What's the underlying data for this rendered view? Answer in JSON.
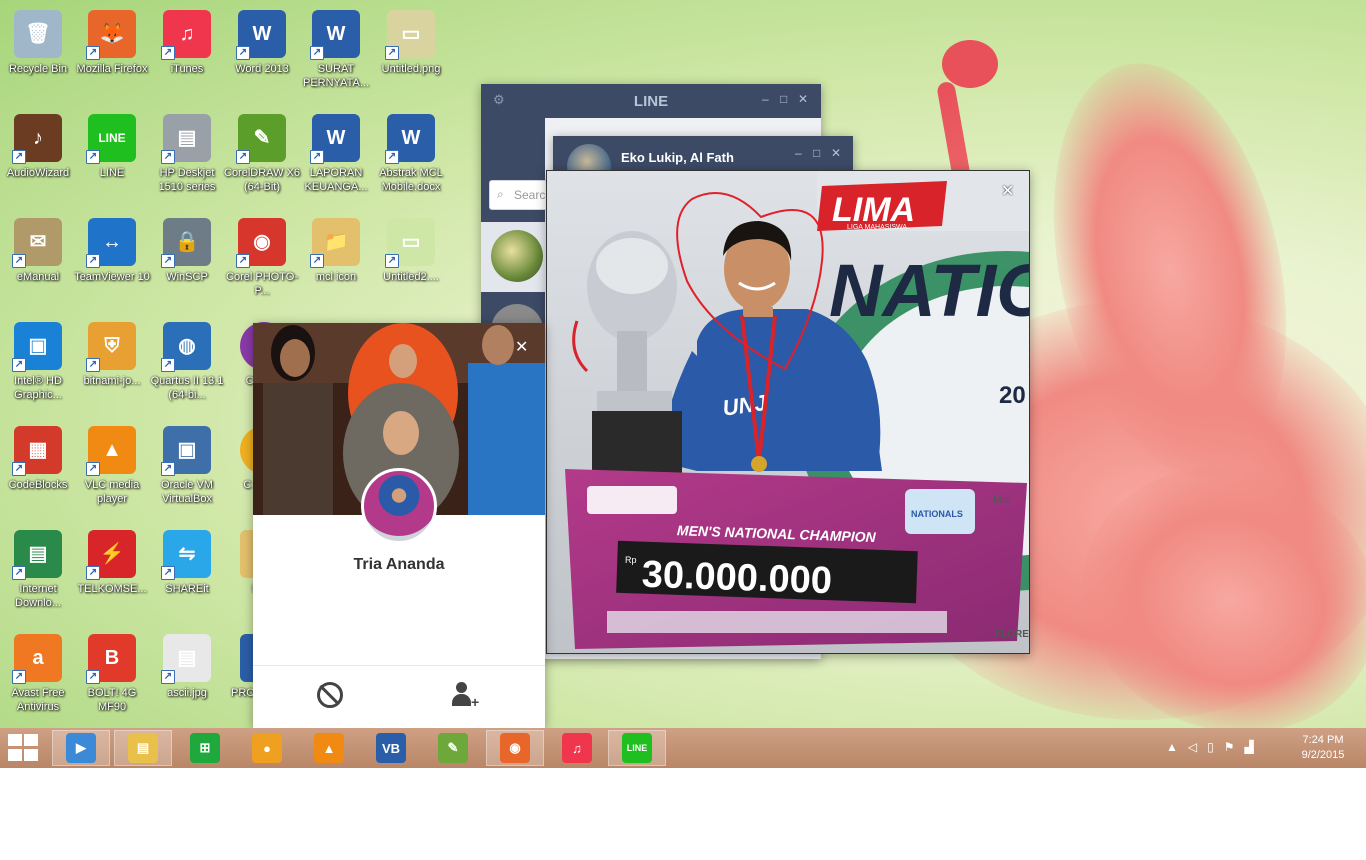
{
  "desktop_icons": [
    {
      "label": "Recycle Bin",
      "glyph": "🗑",
      "color": "#9fb7c9"
    },
    {
      "label": "Mozilla Firefox",
      "glyph": "🦊",
      "color": "#e8662a"
    },
    {
      "label": "iTunes",
      "glyph": "♫",
      "color": "#f0364c"
    },
    {
      "label": "Word 2013",
      "glyph": "W",
      "color": "#2b5ea8"
    },
    {
      "label": "SURAT PERNYATA...",
      "glyph": "W",
      "color": "#2b5ea8"
    },
    {
      "label": "Untitled.png",
      "glyph": "▭",
      "color": "#d9d3a0"
    },
    {
      "label": "AudioWizard",
      "glyph": "♪",
      "color": "#6b3b22"
    },
    {
      "label": "LINE",
      "glyph": "LINE",
      "color": "#1ebf1e"
    },
    {
      "label": "HP Deskjet 1510 series",
      "glyph": "▤",
      "color": "#9aa0a8"
    },
    {
      "label": "CorelDRAW X6 (64-Bit)",
      "glyph": "✎",
      "color": "#5c9e2a"
    },
    {
      "label": "LAPORAN KEUANGA...",
      "glyph": "W",
      "color": "#2b5ea8"
    },
    {
      "label": "Abstrak MCL Mobile.docx",
      "glyph": "W",
      "color": "#2b5ea8"
    },
    {
      "label": "eManual",
      "glyph": "✉",
      "color": "#b09a6a"
    },
    {
      "label": "TeamViewer 10",
      "glyph": "↔",
      "color": "#1f74c9"
    },
    {
      "label": "WinSCP",
      "glyph": "🔒",
      "color": "#6e7c88"
    },
    {
      "label": "Corel PHOTO-P...",
      "glyph": "◉",
      "color": "#d6362b"
    },
    {
      "label": "mcl icon",
      "glyph": "📁",
      "color": "#e2c06c"
    },
    {
      "label": "Untitled2....",
      "glyph": "▭",
      "color": "#cfe7a6"
    },
    {
      "label": "Intel® HD Graphic...",
      "glyph": "▣",
      "color": "#1a82d6"
    },
    {
      "label": "bitnami-jo...",
      "glyph": "⛨",
      "color": "#e8a032"
    },
    {
      "label": "Quartus II 13.1 (64-bi...",
      "glyph": "◍",
      "color": "#2a6fb8"
    },
    {
      "label": "CodeBlocks",
      "glyph": "▦",
      "color": "#d43a2a"
    },
    {
      "label": "VLC media player",
      "glyph": "▲",
      "color": "#f08a12"
    },
    {
      "label": "Oracle VM VirtualBox",
      "glyph": "▣",
      "color": "#3f6fa8"
    },
    {
      "label": "Internet Downlo...",
      "glyph": "▤",
      "color": "#2a8a4a"
    },
    {
      "label": "TELKOMSE...",
      "glyph": "⚡",
      "color": "#d8252a"
    },
    {
      "label": "SHAREit",
      "glyph": "⇋",
      "color": "#2aa7e8"
    },
    {
      "label": "Avast Free Antivirus",
      "glyph": "a",
      "color": "#f07822"
    },
    {
      "label": "BOLT! 4G MF90",
      "glyph": "B",
      "color": "#e23a2a"
    },
    {
      "label": "ascii.jpg",
      "glyph": "▤",
      "color": "#e8e8e8"
    }
  ],
  "partial_icons": [
    {
      "label": "C CO...",
      "color": "#8a3aa8"
    },
    {
      "label": "C CAP...",
      "color": "#f0b020"
    },
    {
      "label": "PR...",
      "color": "#e2c06c"
    },
    {
      "label": "PRO LENG...",
      "color": "#2b5ea8"
    }
  ],
  "line_main": {
    "title": "LINE",
    "search_placeholder": "Search"
  },
  "chat_window": {
    "title": "Eko Lukip, Al Fath"
  },
  "profile": {
    "name": "Tria Ananda",
    "cover_colors": {
      "bg": "#4a2a1e",
      "hijab1": "#e8521e",
      "hijab2": "#6e6a62",
      "shirt": "#2a74c4"
    }
  },
  "photo": {
    "banner": "LIMA",
    "subbanner": "LIGA MAHASISWA",
    "event": "NATIO",
    "year": "20",
    "check_title": "MEN'S NATIONAL CHAMPION",
    "check_prefix": "Rp",
    "check_amount": "30.000.000",
    "shirt_text": "UNJ",
    "sponsor_right": "Mic",
    "floor_text": "FLORE",
    "badge": "NATIONALS"
  },
  "taskbar": {
    "time": "7:24 PM",
    "date": "9/2/2015",
    "apps": [
      {
        "name": "media-player",
        "glyph": "▶",
        "color": "#3a8ad8"
      },
      {
        "name": "file-explorer",
        "glyph": "▤",
        "color": "#e8c04a"
      },
      {
        "name": "store",
        "glyph": "⊞",
        "color": "#1fa83c"
      },
      {
        "name": "browser-orb",
        "glyph": "●",
        "color": "#f0a020"
      },
      {
        "name": "vlc",
        "glyph": "▲",
        "color": "#f08a12"
      },
      {
        "name": "virtualbox",
        "glyph": "VB",
        "color": "#2a5ea8"
      },
      {
        "name": "notepad",
        "glyph": "✎",
        "color": "#6ea83a"
      },
      {
        "name": "firefox",
        "glyph": "◉",
        "color": "#e8662a"
      },
      {
        "name": "itunes",
        "glyph": "♫",
        "color": "#f0364c"
      },
      {
        "name": "line",
        "glyph": "LINE",
        "color": "#1ebf1e"
      }
    ]
  }
}
